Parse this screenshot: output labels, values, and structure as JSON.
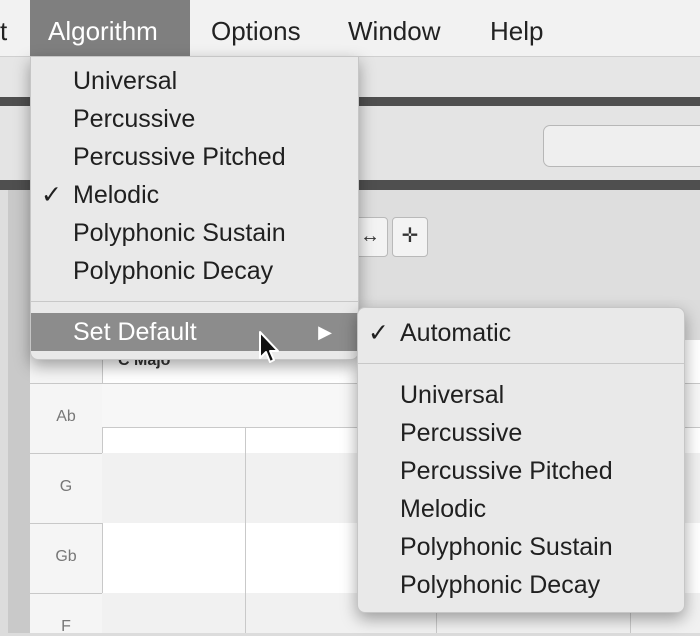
{
  "menubar": {
    "items": [
      "t",
      "Algorithm",
      "Options",
      "Window",
      "Help"
    ]
  },
  "algorithm_menu": {
    "items": [
      {
        "label": "Universal",
        "checked": false
      },
      {
        "label": "Percussive",
        "checked": false
      },
      {
        "label": "Percussive Pitched",
        "checked": false
      },
      {
        "label": "Melodic",
        "checked": true
      },
      {
        "label": "Polyphonic Sustain",
        "checked": false
      },
      {
        "label": "Polyphonic Decay",
        "checked": false
      }
    ],
    "set_default_label": "Set Default",
    "submenu_arrow": "▶"
  },
  "default_submenu": {
    "automatic_label": "Automatic",
    "check_mark": "✓",
    "items": [
      "Universal",
      "Percussive",
      "Percussive Pitched",
      "Melodic",
      "Polyphonic Sustain",
      "Polyphonic Decay"
    ]
  },
  "check_mark": "✓",
  "toolbar": {
    "tool1_icon": "horizontal-arrows-icon",
    "tool2_icon": "crosshair-move-icon"
  },
  "grid": {
    "chord_label": "C Majo",
    "keys": [
      "Ab",
      "G",
      "Gb",
      "F"
    ]
  }
}
